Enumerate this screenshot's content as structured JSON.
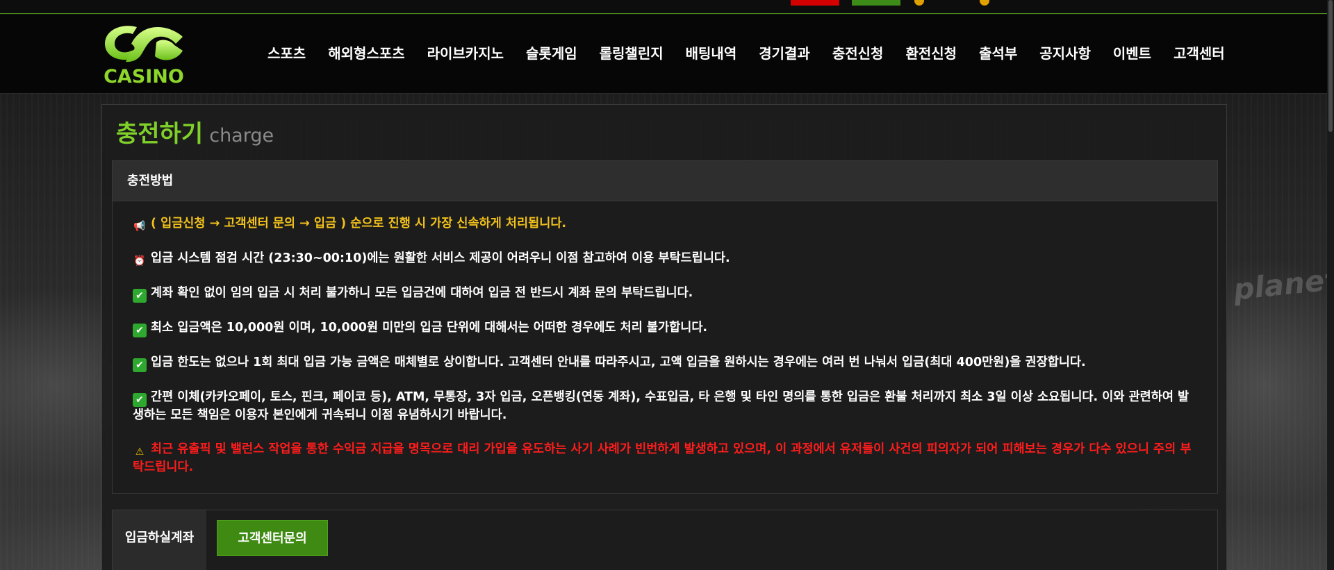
{
  "top_strip": {
    "red_badge_color": "#d40000",
    "green_badge_color": "#3d8c1a"
  },
  "header": {
    "logo_text": "CASINO",
    "nav": [
      "스포츠",
      "해외형스포츠",
      "라이브카지노",
      "슬롯게임",
      "롤링챌린지",
      "배팅내역",
      "경기결과",
      "충전신청",
      "환전신청",
      "출석부",
      "공지사항",
      "이벤트",
      "고객센터"
    ]
  },
  "page": {
    "title_ko": "충전하기",
    "title_en": "charge"
  },
  "method": {
    "header": "충전방법",
    "notices": [
      {
        "icon": "megaphone-icon",
        "color": "yellow",
        "text": "( 입금신청 → 고객센터 문의 → 입금 ) 순으로 진행 시 가장 신속하게 처리됩니다."
      },
      {
        "icon": "alarm-clock-icon",
        "color": "white",
        "text": "입금 시스템 점검 시간 (23:30~00:10)에는 원활한 서비스 제공이 어려우니 이점 참고하여 이용 부탁드립니다."
      },
      {
        "icon": "check-icon",
        "color": "white",
        "text": "계좌 확인 없이 임의 입금 시 처리 불가하니 모든 입금건에 대하여 입금 전 반드시 계좌 문의 부탁드립니다."
      },
      {
        "icon": "check-icon",
        "color": "white",
        "text": "최소 입금액은 10,000원 이며, 10,000원 미만의 입금 단위에 대해서는 어떠한 경우에도 처리 불가합니다."
      },
      {
        "icon": "check-icon",
        "color": "white",
        "text": "입금 한도는 없으나 1회 최대 입금 가능 금액은 매체별로 상이합니다. 고객센터 안내를 따라주시고, 고액 입금을 원하시는 경우에는 여러 번 나눠서 입금(최대 400만원)을 권장합니다."
      },
      {
        "icon": "check-icon",
        "color": "white",
        "text": "간편 이체(카카오페이, 토스, 핀크, 페이코 등), ATM, 무통장, 3자 입금, 오픈뱅킹(연동 계좌), 수표입금, 타 은행 및 타인 명의를 통한 입금은 환불 처리까지 최소 3일 이상 소요됩니다. 이와 관련하여 발생하는 모든 책임은 이용자 본인에게 귀속되니 이점 유념하시기 바랍니다."
      },
      {
        "icon": "warning-icon",
        "color": "red",
        "text": "최근 유출픽 및 밸런스 작업을 통한 수익금 지급을 명목으로 대리 가입을 유도하는 사기 사례가 빈번하게 발생하고 있으며, 이 과정에서 유저들이 사건의 피의자가 되어 피해보는 경우가 다수 있으니 주의 부탁드립니다."
      }
    ]
  },
  "account": {
    "label": "입금하실계좌",
    "button": "고객센터문의"
  },
  "colors": {
    "accent_green": "#7fd12a",
    "button_green": "#3f8a12",
    "notice_yellow": "#f2c21b",
    "notice_red": "#ff1c1c"
  }
}
